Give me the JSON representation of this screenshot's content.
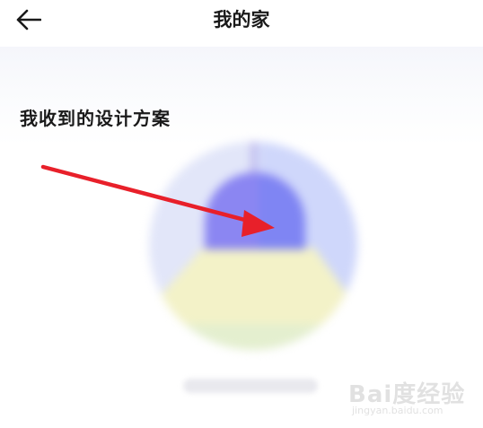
{
  "header": {
    "title": "我的家",
    "back_icon": "arrow-left-icon"
  },
  "section": {
    "title": "我收到的设计方案"
  },
  "empty_state": {
    "illustration_icon": "lamp-illustration-icon",
    "colors": {
      "circle": "#e2e6f9",
      "circle_right": "#cfd7fb",
      "lampshade": "#8b86f2",
      "light_beam": "#f3f2c8",
      "floor": "#e4efcf"
    }
  },
  "annotation": {
    "arrow_color": "#e8202a"
  },
  "watermark": {
    "line1": "Bai度经验",
    "line2": "jingyan.baidu.com"
  }
}
